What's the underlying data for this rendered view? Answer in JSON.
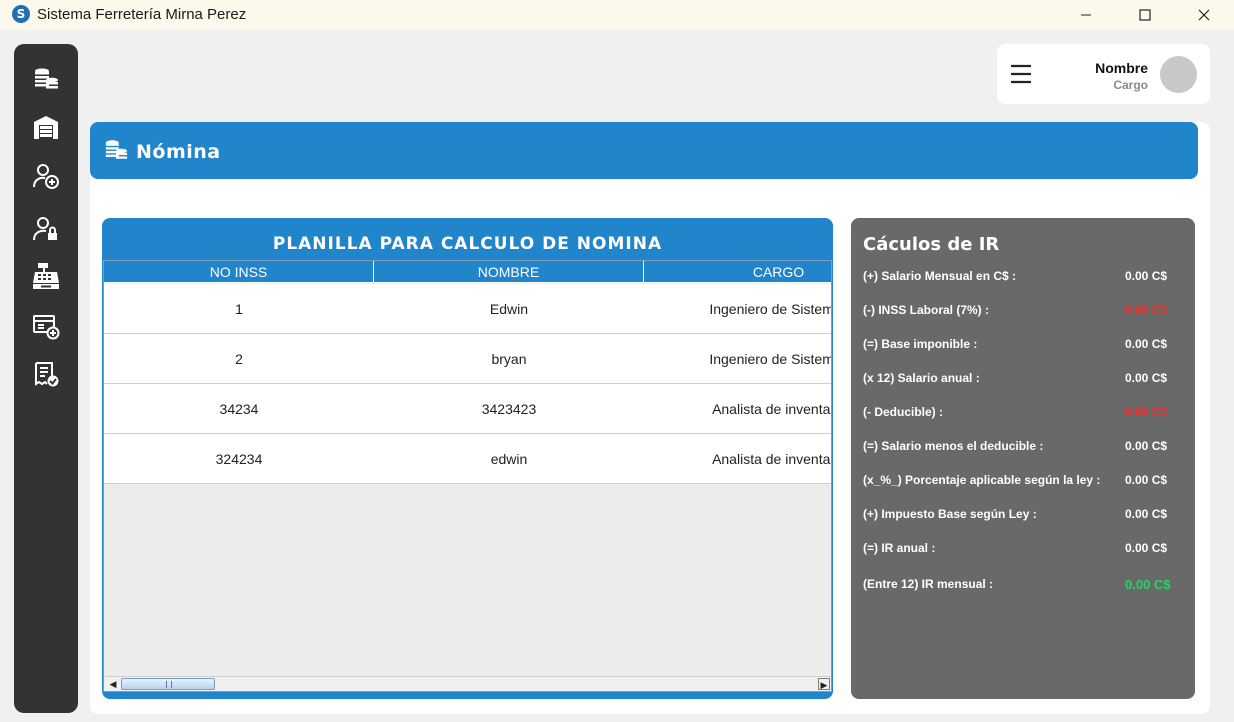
{
  "window": {
    "title": "Sistema Ferretería Mirna Perez",
    "icon_letter": "S"
  },
  "profile": {
    "name": "Nombre",
    "role": "Cargo"
  },
  "header": {
    "title": "Nómina"
  },
  "table": {
    "title": "PLANILLA PARA CALCULO DE NOMINA",
    "columns": [
      "NO INSS",
      "NOMBRE",
      "CARGO"
    ],
    "rows": [
      [
        "1",
        "Edwin",
        "Ingeniero de Sistemas"
      ],
      [
        "2",
        "bryan",
        "Ingeniero de Sistemas"
      ],
      [
        "34234",
        "3423423",
        "Analista de inventario"
      ],
      [
        "324234",
        "edwin",
        "Analista de inventario"
      ]
    ]
  },
  "ir": {
    "title": "Cáculos de IR",
    "rows": [
      {
        "label": "(+) Salario Mensual en C$ :",
        "value": "0.00 C$",
        "status": "normal"
      },
      {
        "label": "(-) INSS Laboral (7%) :",
        "value": "0.00 C$",
        "status": "negative"
      },
      {
        "label": "(=) Base imponible :",
        "value": "0.00 C$",
        "status": "normal"
      },
      {
        "label": "(x 12) Salario anual :",
        "value": "0.00 C$",
        "status": "normal"
      },
      {
        "label": "(- Deducible) :",
        "value": "0.00 C$",
        "status": "negative"
      },
      {
        "label": "(=) Salario menos el deducible :",
        "value": "0.00 C$",
        "status": "normal"
      },
      {
        "label": "(x_%_) Porcentaje aplicable según la ley :",
        "value": "0.00 C$",
        "status": "normal"
      },
      {
        "label": "(+) Impuesto Base según Ley :",
        "value": "0.00 C$",
        "status": "normal"
      },
      {
        "label": "(=) IR anual :",
        "value": "0.00 C$",
        "status": "normal"
      },
      {
        "label": "(Entre 12) IR mensual :",
        "value": "0.00 C$",
        "status": "result"
      }
    ]
  },
  "sidebar": {
    "items": [
      {
        "icon": "coins-icon"
      },
      {
        "icon": "warehouse-icon"
      },
      {
        "icon": "add-user-icon"
      },
      {
        "icon": "user-lock-icon"
      },
      {
        "icon": "cash-register-icon"
      },
      {
        "icon": "add-invoice-icon"
      },
      {
        "icon": "checked-receipt-icon"
      }
    ]
  },
  "colors": {
    "accent": "#2185cc",
    "sidebar": "#333333",
    "ir_panel": "#696969",
    "negative": "#ff2a2a",
    "result": "#1ed760"
  }
}
